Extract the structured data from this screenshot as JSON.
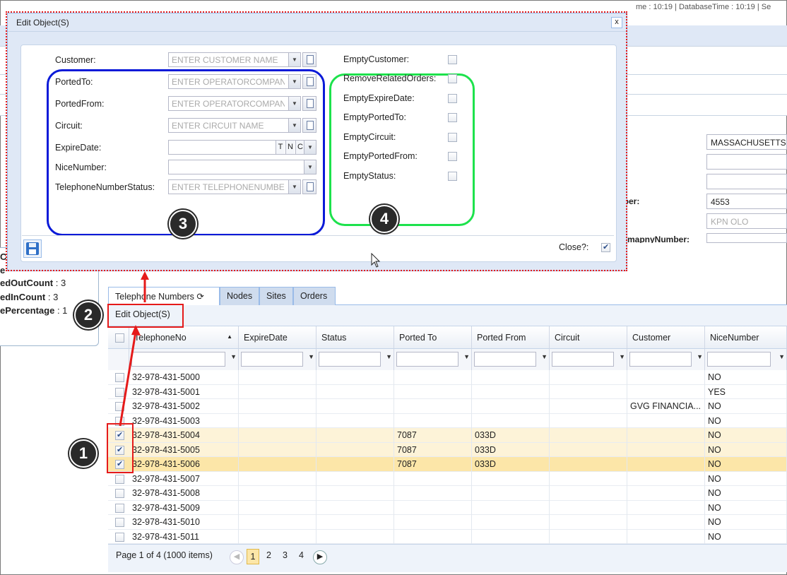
{
  "app": {
    "title_fragment": "me : 10:19 | DatabaseTime : 10:19 | Se",
    "left_fragment": "e"
  },
  "stats": [
    {
      "prefix": "C",
      "value": ""
    },
    {
      "prefix": "e",
      "value": ""
    },
    {
      "prefix": "edOutCount",
      "value": ": 3"
    },
    {
      "prefix": "edInCount",
      "value": ": 3"
    },
    {
      "prefix": "ePercentage",
      "value": ": 1"
    }
  ],
  "background_form": {
    "fields": [
      "MASSACHUSETTS",
      "",
      "",
      "4553",
      "KPN OLO",
      ""
    ],
    "labels": [
      "mber:",
      "ComapnyNumber:"
    ]
  },
  "dialog": {
    "title": "Edit Object(S)",
    "close": "x",
    "fields": [
      {
        "label": "Customer:",
        "placeholder": "ENTER CUSTOMER NAME"
      },
      {
        "label": "PortedTo:",
        "placeholder": "ENTER OPERATORCOMPANY"
      },
      {
        "label": "PortedFrom:",
        "placeholder": "ENTER OPERATORCOMPANY"
      },
      {
        "label": "Circuit:",
        "placeholder": "ENTER CIRCUIT NAME"
      },
      {
        "label": "ExpireDate:",
        "placeholder": ""
      },
      {
        "label": "NiceNumber:",
        "placeholder": ""
      },
      {
        "label": "TelephoneNumberStatus:",
        "placeholder": "ENTER TELEPHONENUMBER"
      }
    ],
    "date_buttons": [
      "T",
      "N",
      "C"
    ],
    "checks": [
      {
        "label": "EmptyCustomer:"
      },
      {
        "label": "RemoveRelatedOrders:"
      },
      {
        "label": "EmptyExpireDate:"
      },
      {
        "label": "EmptyPortedTo:"
      },
      {
        "label": "EmptyCircuit:"
      },
      {
        "label": "EmptyPortedFrom:"
      },
      {
        "label": "EmptyStatus:"
      }
    ],
    "close_label": "Close?:"
  },
  "badges": [
    "1",
    "2",
    "3",
    "4"
  ],
  "tabs": [
    {
      "label": "Telephone Numbers"
    },
    {
      "label": "Nodes"
    },
    {
      "label": "Sites"
    },
    {
      "label": "Orders"
    }
  ],
  "toolbar": {
    "edit_label": "Edit Object(S)"
  },
  "grid": {
    "columns": [
      "TelephoneNo",
      "ExpireDate",
      "Status",
      "Ported To",
      "Ported From",
      "Circuit",
      "Customer",
      "NiceNumber"
    ],
    "rows": [
      {
        "checked": false,
        "cells": [
          "32-978-431-5000",
          "",
          "",
          "",
          "",
          "",
          "",
          "NO"
        ]
      },
      {
        "checked": false,
        "cells": [
          "32-978-431-5001",
          "",
          "",
          "",
          "",
          "",
          "",
          "YES"
        ]
      },
      {
        "checked": false,
        "cells": [
          "32-978-431-5002",
          "",
          "",
          "",
          "",
          "",
          "GVG FINANCIA...",
          "NO"
        ]
      },
      {
        "checked": false,
        "cells": [
          "32-978-431-5003",
          "",
          "",
          "",
          "",
          "",
          "",
          "NO"
        ]
      },
      {
        "checked": true,
        "cells": [
          "32-978-431-5004",
          "",
          "",
          "7087",
          "033D",
          "",
          "",
          "NO"
        ]
      },
      {
        "checked": true,
        "cells": [
          "32-978-431-5005",
          "",
          "",
          "7087",
          "033D",
          "",
          "",
          "NO"
        ]
      },
      {
        "checked": true,
        "cells": [
          "32-978-431-5006",
          "",
          "",
          "7087",
          "033D",
          "",
          "",
          "NO"
        ]
      },
      {
        "checked": false,
        "cells": [
          "32-978-431-5007",
          "",
          "",
          "",
          "",
          "",
          "",
          "NO"
        ]
      },
      {
        "checked": false,
        "cells": [
          "32-978-431-5008",
          "",
          "",
          "",
          "",
          "",
          "",
          "NO"
        ]
      },
      {
        "checked": false,
        "cells": [
          "32-978-431-5009",
          "",
          "",
          "",
          "",
          "",
          "",
          "NO"
        ]
      },
      {
        "checked": false,
        "cells": [
          "32-978-431-5010",
          "",
          "",
          "",
          "",
          "",
          "",
          "NO"
        ]
      },
      {
        "checked": false,
        "cells": [
          "32-978-431-5011",
          "",
          "",
          "",
          "",
          "",
          "",
          "NO"
        ]
      }
    ]
  },
  "pager": {
    "info": "Page 1 of 4 (1000 items)",
    "pages": [
      "1",
      "2",
      "3",
      "4"
    ],
    "current": "1"
  },
  "colors": {
    "accent_red": "#e51a1a",
    "blue_circle": "#0a1ad8",
    "green_circle": "#1de24c",
    "selected_row": "#fdf3d8"
  }
}
